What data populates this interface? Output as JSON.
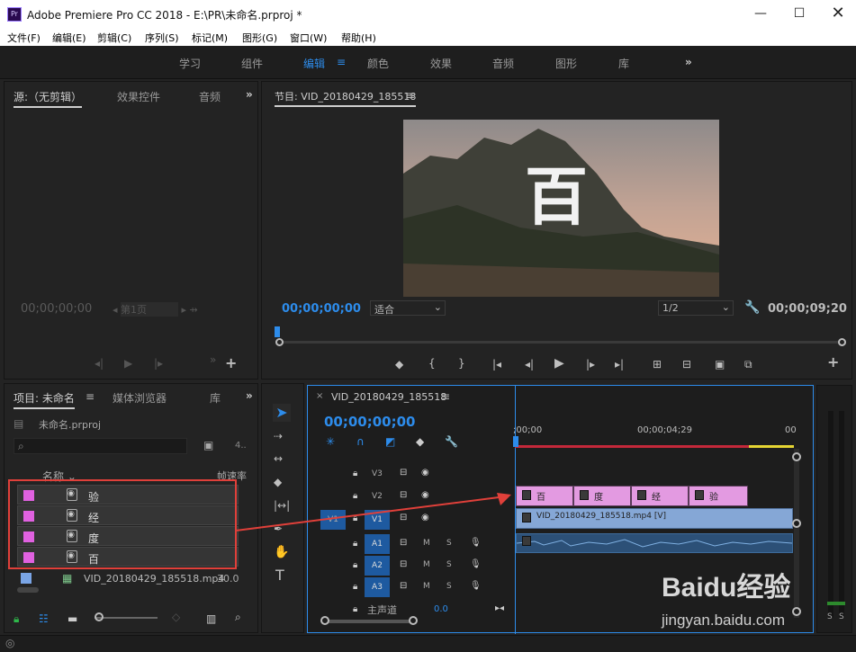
{
  "window": {
    "title": "Adobe Premiere Pro CC 2018 - E:\\PR\\未命名.prproj *",
    "logo": "Pr"
  },
  "menu": [
    "文件(F)",
    "编辑(E)",
    "剪辑(C)",
    "序列(S)",
    "标记(M)",
    "图形(G)",
    "窗口(W)",
    "帮助(H)"
  ],
  "workspaces": [
    "学习",
    "组件",
    "编辑",
    "颜色",
    "效果",
    "音频",
    "图形",
    "库"
  ],
  "workspace_active_menu": "≡",
  "more": "»",
  "source": {
    "tab": "源:（无剪辑）",
    "tab2": "效果控件",
    "tab3": "音频",
    "timecode": "00;00;00;00",
    "page": "第1页"
  },
  "program": {
    "tab": "节目: VID_20180429_185518",
    "timecode": "00;00;00;00",
    "fit": "适合",
    "res": "1/2",
    "duration": "00;00;09;20",
    "overlay_text": "百"
  },
  "project": {
    "tab": "项目: 未命名",
    "tab2": "媒体浏览器",
    "tab3": "库",
    "file": "未命名.prproj",
    "count": "4..",
    "col_name": "名称",
    "col_fps": "帧速率",
    "items": [
      {
        "name": "验"
      },
      {
        "name": "经"
      },
      {
        "name": "度"
      },
      {
        "name": "百"
      }
    ],
    "video_item": {
      "name": "VID_20180429_185518.mp4",
      "fps": "30.0"
    }
  },
  "timeline": {
    "tab": "VID_20180429_185518",
    "timecode": "00;00;00;00",
    "ruler": [
      ";00;00",
      "00;00;04;29",
      "00"
    ],
    "tracks": [
      "V3",
      "V2",
      "V1",
      "A1",
      "A2",
      "A3"
    ],
    "src_v": "V1",
    "master": "主声道",
    "master_val": "0.0",
    "m": "M",
    "s": "S",
    "clips_v2": [
      "百",
      "度",
      "经",
      "验"
    ],
    "clip_v1": "VID_20180429_185518.mp4 [V]"
  },
  "meter": {
    "s1": "S",
    "s2": "S"
  },
  "watermark": {
    "brand": "Baidu经验",
    "url": "jingyan.baidu.com"
  },
  "colors": {
    "accent": "#2d8ceb",
    "clip_pink": "#e39ae1",
    "clip_blue": "#85a7d6",
    "annotation": "#e0403a"
  }
}
